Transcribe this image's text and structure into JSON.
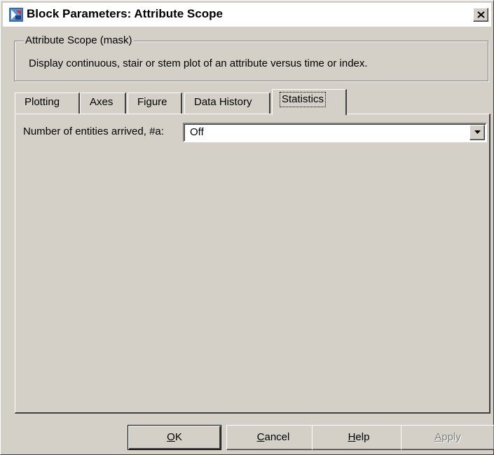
{
  "window": {
    "title": "Block Parameters: Attribute Scope",
    "close_glyph": "×"
  },
  "mask": {
    "group_title": "Attribute Scope (mask)",
    "description": "Display continuous, stair or stem plot of an attribute versus time or index."
  },
  "tabs": [
    {
      "label": "Plotting",
      "active": false
    },
    {
      "label": "Axes",
      "active": false
    },
    {
      "label": "Figure",
      "active": false
    },
    {
      "label": "Data History",
      "active": false
    },
    {
      "label": "Statistics",
      "active": true
    }
  ],
  "statistics": {
    "entities_arrived_label": "Number of entities arrived, #a:",
    "entities_arrived_value": "Off"
  },
  "buttons": {
    "ok": {
      "mnemonic": "O",
      "rest": "K"
    },
    "cancel": {
      "mnemonic": "C",
      "rest": "ancel"
    },
    "help": {
      "mnemonic": "H",
      "rest": "elp"
    },
    "apply": {
      "mnemonic": "A",
      "rest": "pply",
      "enabled": false
    }
  },
  "colors": {
    "face": "#d4d0c8",
    "highlight": "#ffffff",
    "shadow": "#808080",
    "dark_shadow": "#404040",
    "disabled_text": "#808080"
  },
  "icons": {
    "title": "simulink-block-icon",
    "close": "close-icon",
    "dropdown": "chevron-down-icon"
  }
}
